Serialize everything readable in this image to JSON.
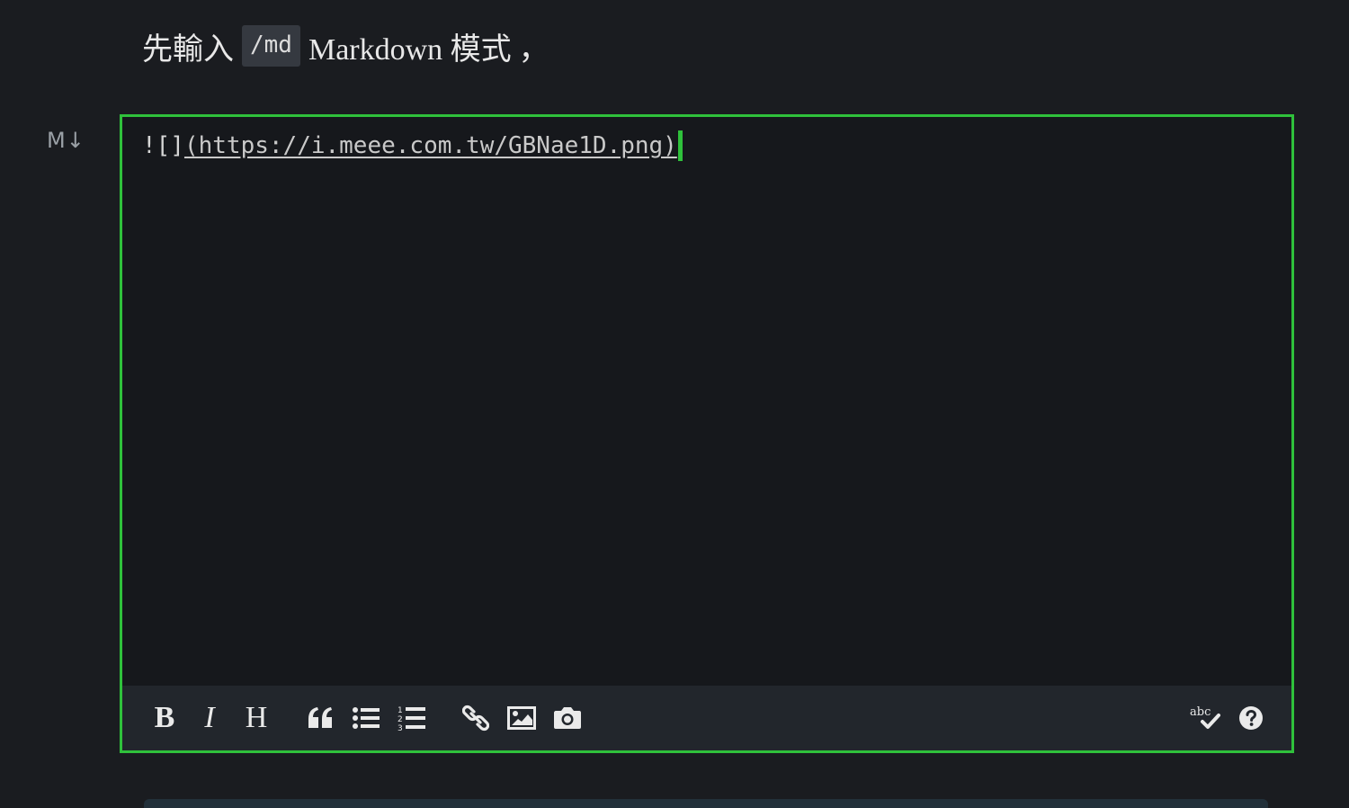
{
  "intro": {
    "prefix": "先輸入",
    "command": "/md",
    "suffix": "Markdown 模式",
    "comma": "，"
  },
  "mode_badge": "M↓",
  "editor": {
    "content_prefix": "![]",
    "content_url": "(https://i.meee.com.tw/GBNae1D.png)",
    "focus_color": "#2fc13b"
  },
  "toolbar": {
    "bold_label": "B",
    "italic_label": "I",
    "heading_label": "H",
    "spellcheck_label": "abc",
    "icons": [
      "bold-icon",
      "italic-icon",
      "heading-icon",
      "quote-icon",
      "unordered-list-icon",
      "ordered-list-icon",
      "link-icon",
      "image-icon",
      "camera-icon",
      "spellcheck-icon",
      "help-icon"
    ]
  }
}
